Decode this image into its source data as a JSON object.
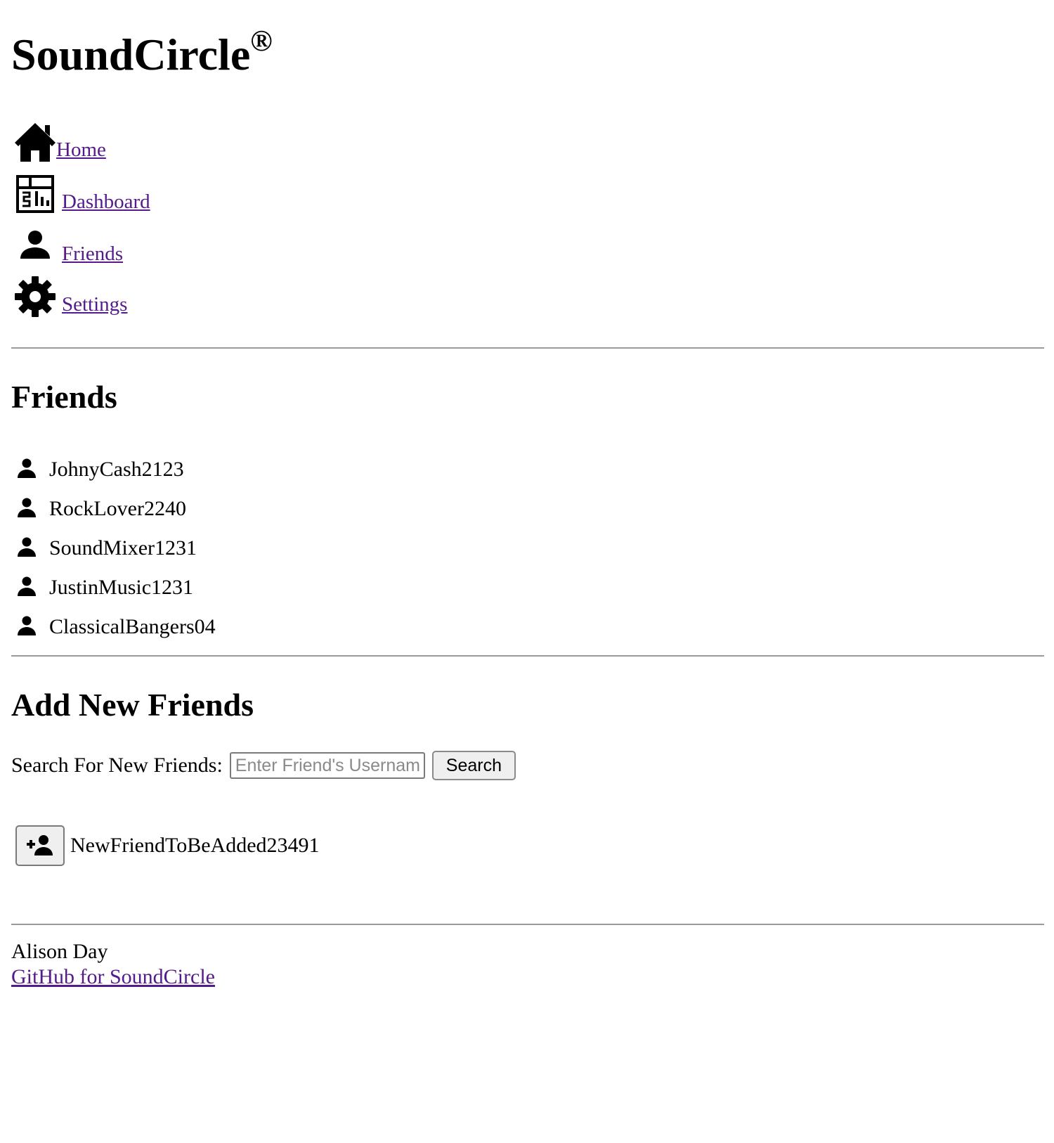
{
  "app": {
    "title": "SoundCircle",
    "title_mark": "®"
  },
  "nav": {
    "items": [
      {
        "label": "Home",
        "icon": "home-icon"
      },
      {
        "label": "Dashboard",
        "icon": "dashboard-icon"
      },
      {
        "label": "Friends",
        "icon": "person-icon"
      },
      {
        "label": "Settings",
        "icon": "gear-icon"
      }
    ]
  },
  "friends": {
    "heading": "Friends",
    "list": [
      {
        "name": "JohnyCash2123",
        "icon": "person-icon"
      },
      {
        "name": "RockLover2240",
        "icon": "person-icon"
      },
      {
        "name": "SoundMixer1231",
        "icon": "person-icon"
      },
      {
        "name": "JustinMusic1231",
        "icon": "person-icon"
      },
      {
        "name": "ClassicalBangers04",
        "icon": "person-icon"
      }
    ]
  },
  "add_friends": {
    "heading": "Add New Friends",
    "search_label": "Search For New Friends:",
    "search_value": "",
    "search_placeholder": "Enter Friend's Username",
    "search_button": "Search",
    "result": {
      "name": "NewFriendToBeAdded23491",
      "icon": "person-add-icon"
    }
  },
  "footer": {
    "author": "Alison Day",
    "link_text": "GitHub for SoundCircle"
  },
  "colors": {
    "link": "#551a8b",
    "divider": "#9a9a9a",
    "button_bg": "#efefef"
  }
}
